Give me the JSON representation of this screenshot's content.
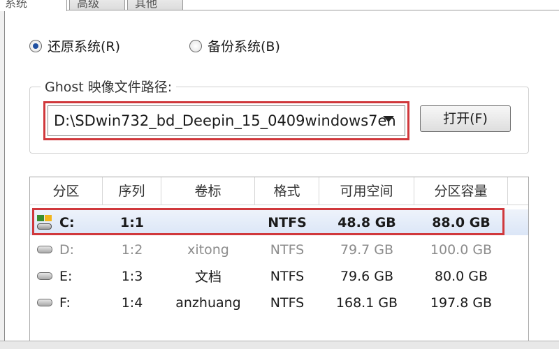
{
  "tabs": [
    {
      "label": "系统"
    },
    {
      "label": "高级"
    },
    {
      "label": "其他"
    }
  ],
  "mode": {
    "restore_label": "还原系统(R)",
    "backup_label": "备份系统(B)",
    "selected": "restore"
  },
  "image_path": {
    "group_label": "Ghost 映像文件路径:",
    "value": "D:\\SDwin732_bd_Deepin_15_0409windows7en",
    "open_label": "打开(F)"
  },
  "partitions": {
    "headers": [
      "分区",
      "序列",
      "卷标",
      "格式",
      "可用空间",
      "分区容量"
    ],
    "rows": [
      {
        "drive": "C:",
        "seq": "1:1",
        "label": "",
        "format": "NTFS",
        "free": "48.8 GB",
        "size": "88.0 GB",
        "state": "selected"
      },
      {
        "drive": "D:",
        "seq": "1:2",
        "label": "xitong",
        "format": "NTFS",
        "free": "79.7 GB",
        "size": "100.0 GB",
        "state": "dim"
      },
      {
        "drive": "E:",
        "seq": "1:3",
        "label": "文档",
        "format": "NTFS",
        "free": "79.6 GB",
        "size": "80.0 GB",
        "state": "normal"
      },
      {
        "drive": "F:",
        "seq": "1:4",
        "label": "anzhuang",
        "format": "NTFS",
        "free": "168.1 GB",
        "size": "197.8 GB",
        "state": "normal"
      }
    ]
  },
  "colors": {
    "highlight_border": "#d0383c",
    "radio_dot": "#1f4fa0",
    "selected_row": "#dbe6f7"
  }
}
